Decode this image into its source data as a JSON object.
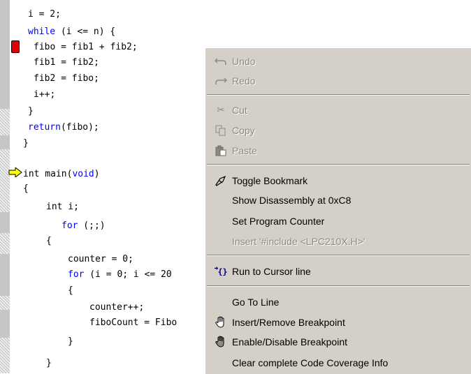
{
  "code_lines": [
    {
      "text": "i = 2;"
    },
    {
      "kw": "while",
      "text": " (i <= n) {"
    },
    {
      "text": "fibo = fib1 + fib2;"
    },
    {
      "text": "fib1 = fib2;"
    },
    {
      "text": "fib2 = fibo;"
    },
    {
      "text": "i++;"
    },
    {
      "text": "}"
    },
    {
      "kw": "return",
      "text": "(fibo);"
    },
    {
      "text": "}"
    },
    {
      "text": "int main(",
      "kw": "void",
      "text2": ")"
    },
    {
      "text": "{"
    },
    {
      "text": "int i;"
    },
    {
      "kw": "for",
      "text": " (;;)"
    },
    {
      "text": "{"
    },
    {
      "text": "counter = 0;"
    },
    {
      "kw": "for",
      "text": " (i = 0; i <= 20"
    },
    {
      "text": "{"
    },
    {
      "text": "counter++;"
    },
    {
      "text": "fiboCount = Fibo"
    },
    {
      "text": "}"
    },
    {
      "text": "}"
    }
  ],
  "context_menu": {
    "undo": "Undo",
    "redo": "Redo",
    "cut": "Cut",
    "copy": "Copy",
    "paste": "Paste",
    "toggle_bookmark": "Toggle Bookmark",
    "show_disassembly": "Show Disassembly at 0xC8",
    "set_program_counter": "Set Program Counter",
    "insert_include": "Insert '#include <LPC210X.H>'",
    "run_to_cursor": "Run to Cursor line",
    "go_to_line": "Go To Line",
    "insert_remove_breakpoint": "Insert/Remove Breakpoint",
    "enable_disable_breakpoint": "Enable/Disable Breakpoint",
    "clear_coverage": "Clear complete Code Coverage Info"
  },
  "icons": {
    "undo": "undo-icon",
    "redo": "redo-icon",
    "cut": "scissors-icon",
    "copy": "copy-icon",
    "paste": "clipboard-icon",
    "bookmark": "bookmark-icon",
    "run_to_cursor": "run-to-cursor-icon",
    "breakpoint": "hand-icon"
  },
  "colors": {
    "keyword": "#0000ff",
    "breakpoint": "#e00000",
    "pc_arrow": "#ffff00",
    "menu_bg": "#d4d0c8"
  }
}
